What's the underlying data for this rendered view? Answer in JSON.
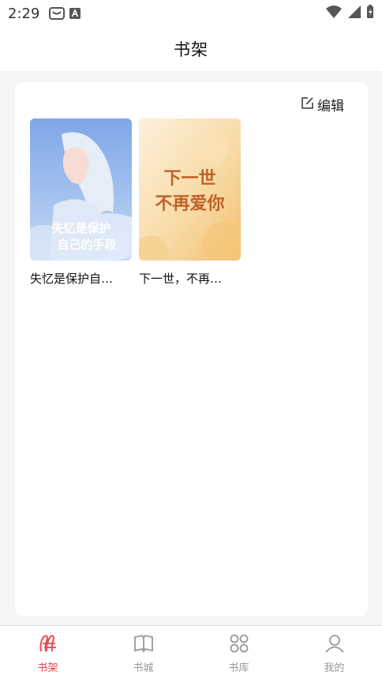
{
  "status_bar": {
    "time": "2:29"
  },
  "header": {
    "title": "书架"
  },
  "shelf": {
    "edit_label": "编辑",
    "books": [
      {
        "title": "失忆是保护自…",
        "cover_title_line1": "失忆是保护",
        "cover_title_line2": "自己的手段"
      },
      {
        "title": "下一世，不再…",
        "cover_title_line1": "下一世",
        "cover_title_line2": "不再爱你"
      }
    ]
  },
  "tabbar": {
    "items": [
      {
        "label": "书架",
        "icon": "bookshelf-icon",
        "active": true
      },
      {
        "label": "书城",
        "icon": "book-open-icon",
        "active": false
      },
      {
        "label": "书库",
        "icon": "grid-icon",
        "active": false
      },
      {
        "label": "我的",
        "icon": "user-icon",
        "active": false
      }
    ]
  },
  "colors": {
    "accent": "#e8484e",
    "inactive": "#999999",
    "background": "#f5f5f5"
  }
}
